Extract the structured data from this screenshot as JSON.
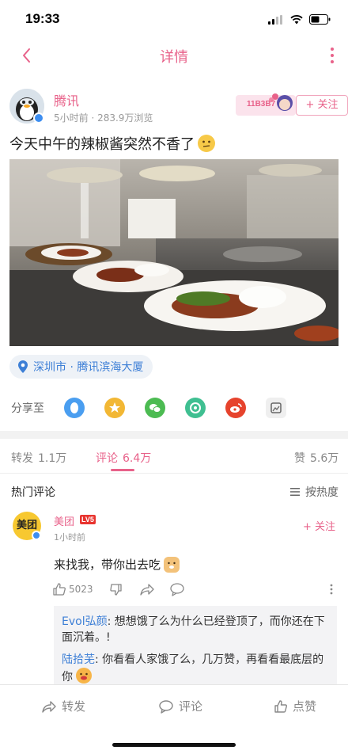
{
  "status": {
    "time": "19:33"
  },
  "nav": {
    "title": "详情"
  },
  "post": {
    "author_name": "腾讯",
    "meta": "5小时前 · 283.9万浏览",
    "badge_text": "11B3B7",
    "follow_label": "+ 关注",
    "text": "今天中午的辣椒酱突然不香了",
    "location": "深圳市 · 腾讯滨海大厦"
  },
  "share": {
    "label": "分享至",
    "icons": [
      "qq-icon",
      "qzone-icon",
      "wechat-icon",
      "moments-icon",
      "weibo-icon",
      "save-image-icon"
    ]
  },
  "tabs": {
    "repost_label": "转发",
    "repost_count": "1.1万",
    "comment_label": "评论",
    "comment_count": "6.4万",
    "like_label": "赞",
    "like_count": "5.6万"
  },
  "hot": {
    "title": "热门评论",
    "sort_label": "按热度"
  },
  "comment": {
    "avatar_text": "美团",
    "name": "美团",
    "level": "LV5",
    "time": "1小时前",
    "follow_label": "+ 关注",
    "text": "来找我，带你出去吃",
    "likes": "5023"
  },
  "replies": [
    {
      "name": "Evol弘颜",
      "text": ": 想想饿了么为什么已经登顶了，而你还在下面沉着。!"
    },
    {
      "name": "陆拾芜",
      "text": ": 你看看人家饿了么，几万赞，再看看最底层的你"
    }
  ],
  "bottom": {
    "repost": "转发",
    "comment": "评论",
    "like": "点赞"
  },
  "colors": {
    "accent": "#e8628a",
    "link": "#3d7fd6"
  }
}
